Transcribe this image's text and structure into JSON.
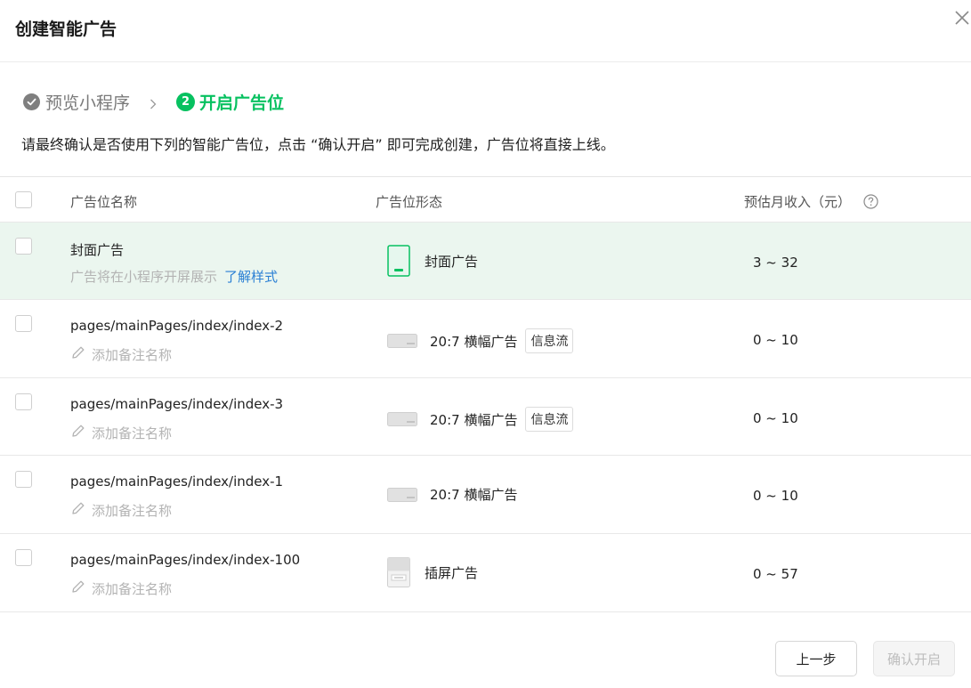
{
  "dialog": {
    "title": "创建智能广告",
    "close_icon": "close-icon"
  },
  "steps": [
    {
      "label": "预览小程序",
      "status": "done",
      "icon": "check-circle-icon"
    },
    {
      "number": "2",
      "label": "开启广告位",
      "status": "active"
    }
  ],
  "instruction": "请最终确认是否使用下列的智能广告位，点击 “确认开启” 即可完成创建，广告位将直接上线。",
  "table": {
    "headers": {
      "name": "广告位名称",
      "form": "广告位形态",
      "revenue": "预估月收入（元）",
      "help_icon": "question-circle-icon"
    },
    "rows": [
      {
        "name": "封面广告",
        "subtitle": "广告将在小程序开屏展示",
        "link": "了解样式",
        "form_label": "封面广告",
        "form_icon": "cover-ad-icon",
        "tag": "",
        "revenue": "3 ~ 32",
        "highlight": true
      },
      {
        "name": "pages/mainPages/index/index-2",
        "remark_placeholder": "添加备注名称",
        "form_label": "20:7 横幅广告",
        "form_icon": "banner-ad-icon",
        "tag": "信息流",
        "revenue": "0 ~ 10"
      },
      {
        "name": "pages/mainPages/index/index-3",
        "remark_placeholder": "添加备注名称",
        "form_label": "20:7 横幅广告",
        "form_icon": "banner-ad-icon",
        "tag": "信息流",
        "revenue": "0 ~ 10"
      },
      {
        "name": "pages/mainPages/index/index-1",
        "remark_placeholder": "添加备注名称",
        "form_label": "20:7 横幅广告",
        "form_icon": "banner-ad-icon",
        "tag": "",
        "revenue": "0 ~ 10"
      },
      {
        "name": "pages/mainPages/index/index-100",
        "remark_placeholder": "添加备注名称",
        "form_label": "插屏广告",
        "form_icon": "interstitial-ad-icon",
        "tag": "",
        "revenue": "0 ~ 57"
      }
    ]
  },
  "footer": {
    "prev_label": "上一步",
    "confirm_label": "确认开启"
  },
  "colors": {
    "accent": "#07c160",
    "link": "#2a7fd4",
    "highlight_row": "#ebf6ef"
  }
}
